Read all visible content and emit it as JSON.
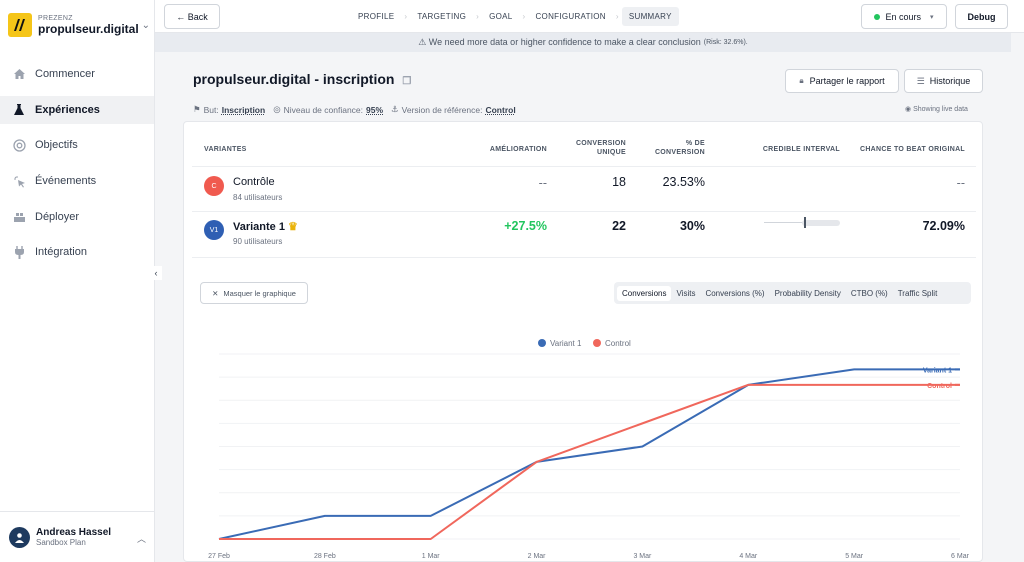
{
  "org": {
    "label": "PREZENZ",
    "name": "propulseur.digital"
  },
  "nav": [
    {
      "label": "Commencer",
      "icon": "home-icon"
    },
    {
      "label": "Expériences",
      "icon": "flask-icon",
      "active": true
    },
    {
      "label": "Objectifs",
      "icon": "target-icon"
    },
    {
      "label": "Événements",
      "icon": "click-icon"
    },
    {
      "label": "Déployer",
      "icon": "deploy-icon"
    },
    {
      "label": "Intégration",
      "icon": "plug-icon"
    }
  ],
  "user": {
    "name": "Andreas Hassel",
    "plan": "Sandbox Plan"
  },
  "topbar": {
    "back": "← Back",
    "steps": [
      "PROFILE",
      "TARGETING",
      "GOAL",
      "CONFIGURATION",
      "SUMMARY"
    ],
    "active_step": "SUMMARY",
    "status": "En cours",
    "debug": "Debug"
  },
  "banner": {
    "text": "⚠ We need more data or higher confidence to make a clear conclusion",
    "risk": "(Risk: 32.6%)."
  },
  "header": {
    "title": "propulseur.digital - inscription",
    "share": "Partager le rapport",
    "history": "Historique",
    "goal_label": "But:",
    "goal": "Inscription",
    "confidence_label": "Niveau de confiance:",
    "confidence": "95%",
    "reference_label": "Version de référence:",
    "reference": "Control",
    "live": "Showing live data"
  },
  "table": {
    "headers": {
      "variants": "VARIANTES",
      "improvement": "AMÉLIORATION",
      "conv1": "CONVERSION",
      "conv2": "UNIQUE",
      "pct1": "% DE",
      "pct2": "CONVERSION",
      "ci": "CREDIBLE INTERVAL",
      "ctbo": "CHANCE TO BEAT ORIGINAL"
    },
    "rows": [
      {
        "badge": "C",
        "name": "Contrôle",
        "users": "84 utilisateurs",
        "improvement": "--",
        "conversions": "18",
        "rate": "23.53%",
        "ctbo": "--",
        "color": "#f05a4f"
      },
      {
        "badge": "V1",
        "name": "Variante 1",
        "users": "90 utilisateurs",
        "improvement": "+27.5%",
        "conversions": "22",
        "rate": "30%",
        "ctbo": "72.09%",
        "color": "#2f5fb3"
      }
    ]
  },
  "chart_controls": {
    "hide": "Masquer le graphique",
    "tabs": [
      "Conversions",
      "Visits",
      "Conversions (%)",
      "Probability Density",
      "CTBO (%)",
      "Traffic Split"
    ],
    "active_tab": "Conversions"
  },
  "chart_data": {
    "type": "line",
    "x": [
      "27 Feb",
      "28 Feb",
      "1 Mar",
      "2 Mar",
      "3 Mar",
      "4 Mar",
      "5 Mar",
      "6 Mar"
    ],
    "series": [
      {
        "name": "Variant 1",
        "color": "#3a6bb5",
        "values": [
          0,
          3,
          3,
          10,
          12,
          20,
          22,
          22
        ]
      },
      {
        "name": "Control",
        "color": "#f0675c",
        "values": [
          0,
          0,
          0,
          10,
          15,
          20,
          20,
          20
        ]
      }
    ],
    "ylim": [
      0,
      24
    ]
  }
}
